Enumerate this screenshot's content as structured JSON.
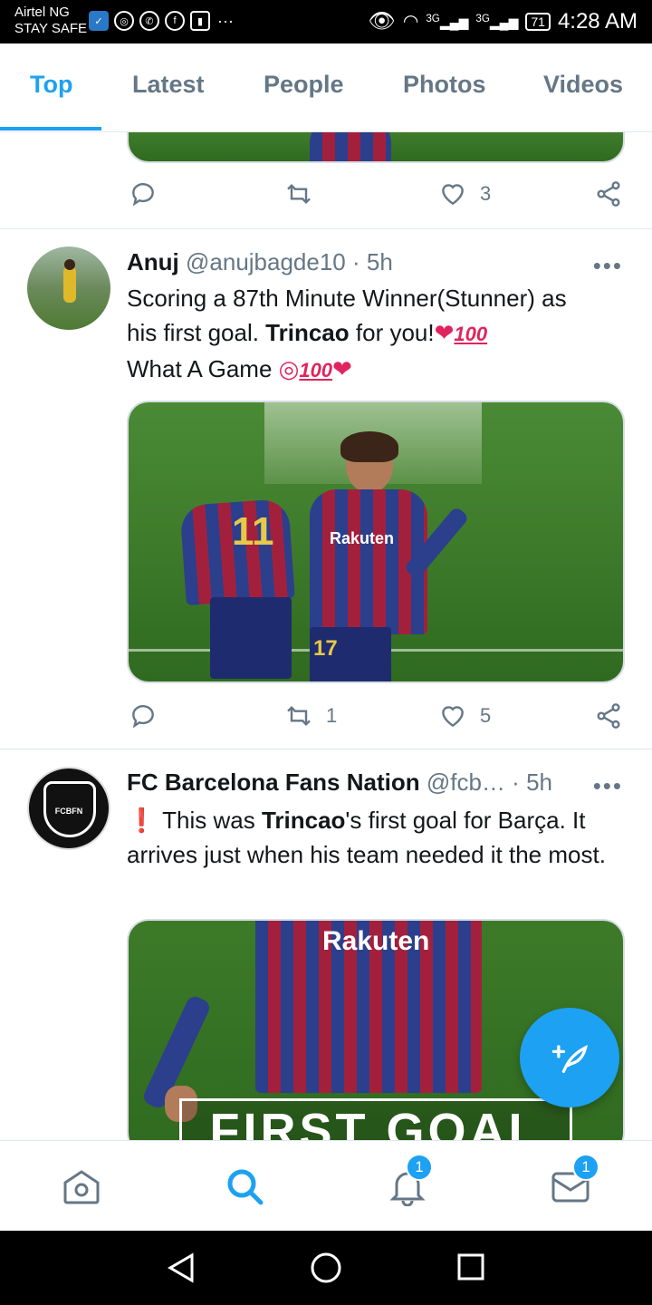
{
  "status_bar": {
    "carrier_line1": "Airtel NG",
    "carrier_line2": "STAY SAFE",
    "network1": "3G",
    "network2": "3G",
    "battery": "71",
    "time": "4:28 AM"
  },
  "tabs": [
    {
      "label": "Top",
      "active": true
    },
    {
      "label": "Latest",
      "active": false
    },
    {
      "label": "People",
      "active": false
    },
    {
      "label": "Photos",
      "active": false
    },
    {
      "label": "Videos",
      "active": false
    }
  ],
  "tweets": [
    {
      "retweets": "",
      "likes": "3"
    },
    {
      "name": "Anuj",
      "handle": "@anujbagde10",
      "sep": "·",
      "time": "5h",
      "more": "•••",
      "text_line1": "Scoring a 87th Minute Winner(Stunner) as",
      "text_line2_pre": "his first goal. ",
      "text_line2_bold": "Trincao",
      "text_line2_post": " for you!",
      "text_line3": "What A Game ",
      "emoji_100": "100",
      "retweets": "1",
      "likes": "5",
      "media_jersey": "17",
      "media_sponsor": "Rakuten",
      "media_jersey2": "11"
    },
    {
      "name": "FC Barcelona Fans Nation",
      "handle": "@fcb…",
      "sep": "·",
      "time": "5h",
      "more": "•••",
      "text_exclaim": "❗",
      "text_pre": " This was ",
      "text_bold": "Trincao",
      "text_post": "'s first goal for Barça. It arrives just when his team needed it the most.",
      "media_caption": "FIRST GOAL",
      "media_sponsor": "Rakuten",
      "avatar_text": "FCBFN"
    }
  ],
  "bottom_nav": {
    "notifications_badge": "1",
    "messages_badge": "1"
  },
  "colors": {
    "accent": "#1da1f2",
    "heart": "#e0245e"
  }
}
